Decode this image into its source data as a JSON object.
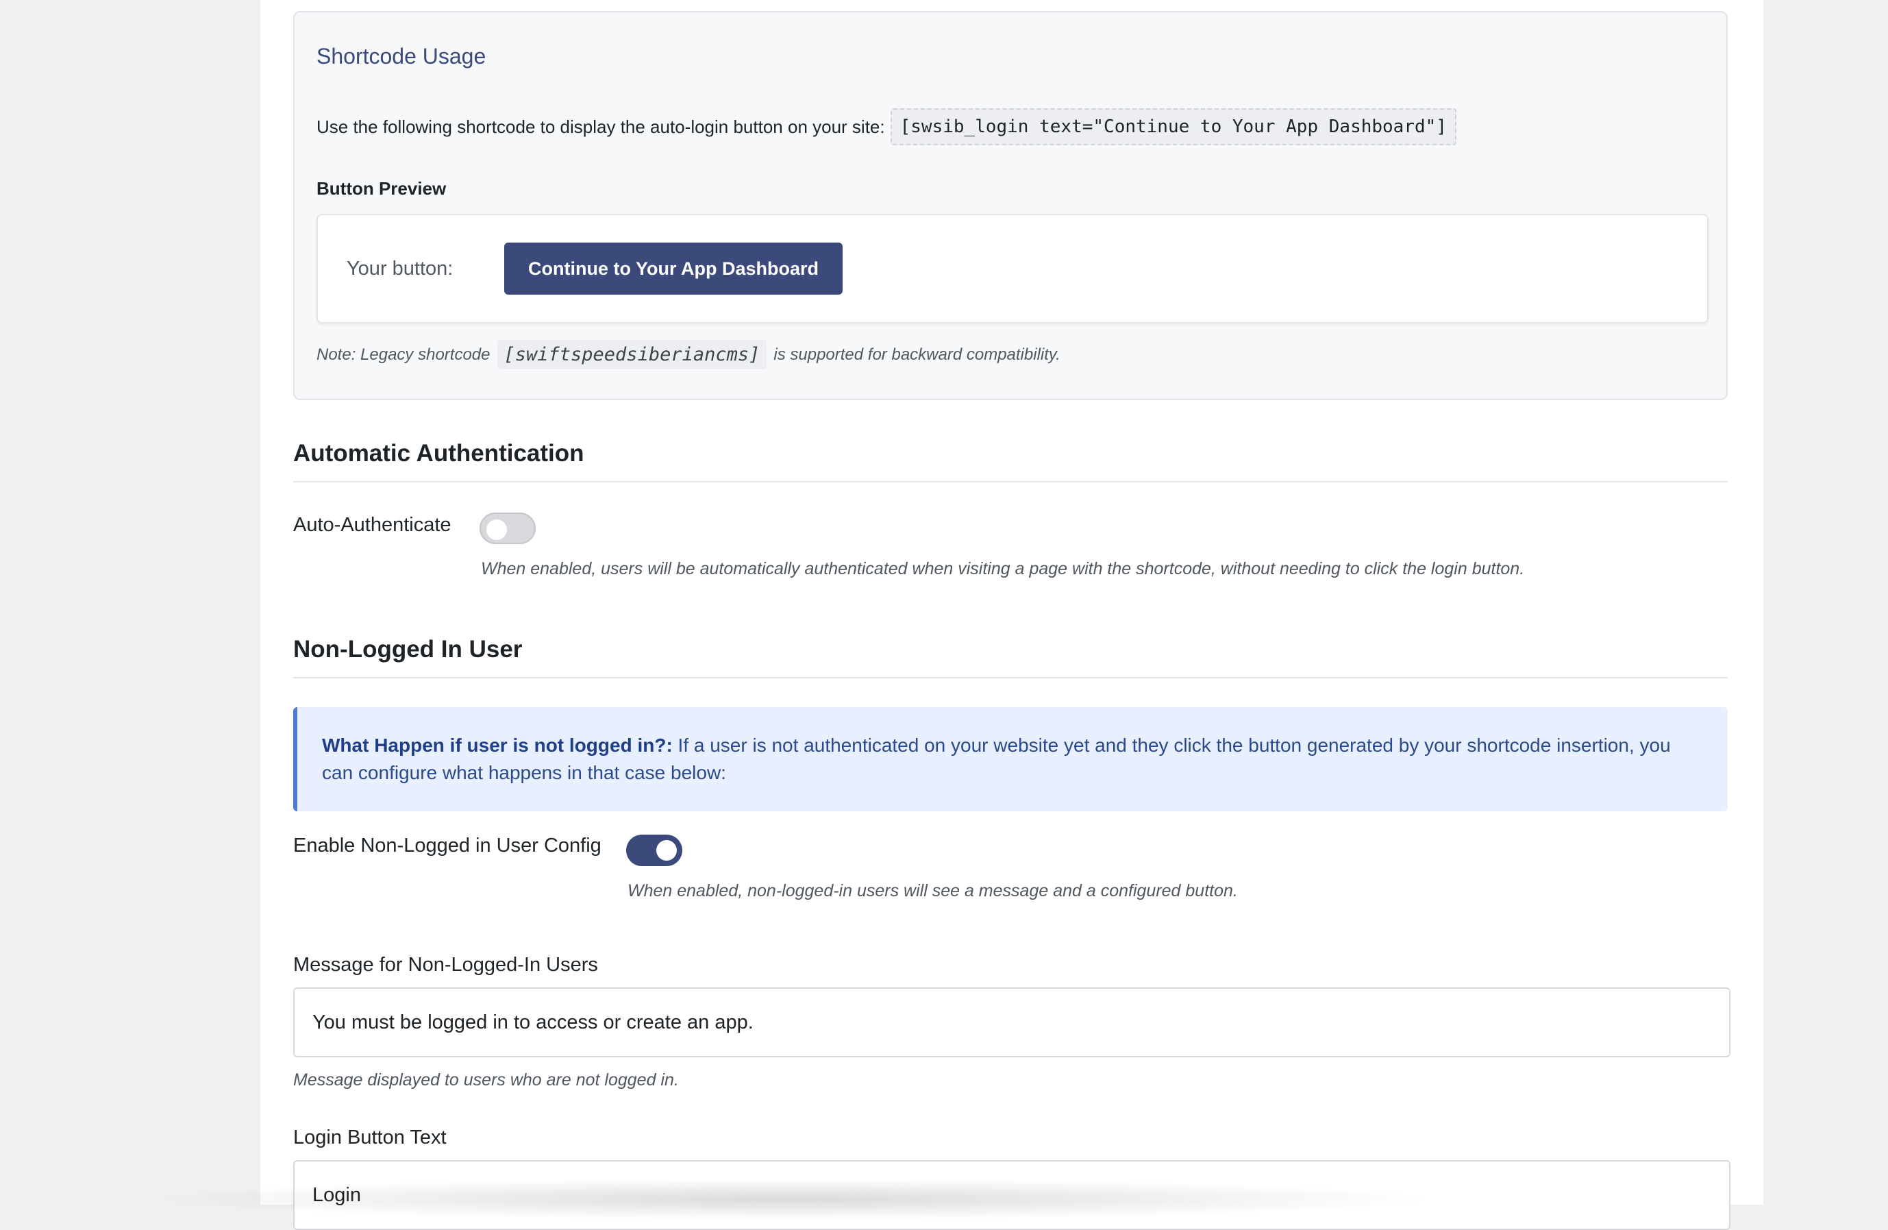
{
  "shortcode_card": {
    "title": "Shortcode Usage",
    "usage_text": "Use the following shortcode to display the auto-login button on your site:",
    "shortcode": "[swsib_login text=\"Continue to Your App Dashboard\"]",
    "preview_label": "Button Preview",
    "preview_prefix": "Your button:",
    "preview_button": "Continue to Your App Dashboard",
    "legacy_prefix": "Note: Legacy shortcode",
    "legacy_code": "[swiftspeedsiberiancms]",
    "legacy_suffix": "is supported for backward compatibility."
  },
  "auto_auth": {
    "section_title": "Automatic Authentication",
    "label": "Auto-Authenticate",
    "enabled": false,
    "helper": "When enabled, users will be automatically authenticated when visiting a page with the shortcode, without needing to click the login button."
  },
  "non_logged": {
    "section_title": "Non-Logged In User",
    "notice_bold": "What Happen if user is not logged in?:",
    "notice_text": "If a user is not authenticated on your website yet and they click the button generated by your shortcode insertion, you can configure what happens in that case below:",
    "enable_label": "Enable Non-Logged in User Config",
    "enabled": true,
    "enable_helper": "When enabled, non-logged-in users will see a message and a configured button.",
    "message_label": "Message for Non-Logged-In Users",
    "message_value": "You must be logged in to access or create an app.",
    "message_helper": "Message displayed to users who are not logged in.",
    "login_button_label": "Login Button Text",
    "login_button_value": "Login"
  },
  "colors": {
    "accent": "#3b4a7a",
    "notice_bg": "#e8efff",
    "notice_border": "#4f79d6"
  }
}
